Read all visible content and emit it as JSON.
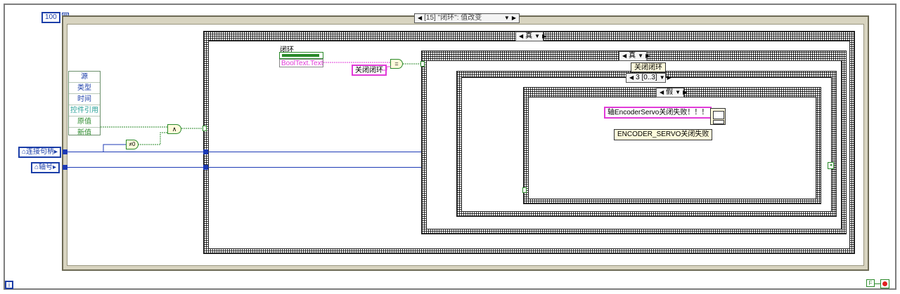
{
  "while_loop": {
    "count_constant": "100",
    "stop_terminal": "F"
  },
  "event_structure": {
    "selector": "[15] \"闭环\": 值改变",
    "event_data_items": [
      {
        "label": "源",
        "color": "#1b3ea8"
      },
      {
        "label": "类型",
        "color": "#1b3ea8"
      },
      {
        "label": "时间",
        "color": "#1b3ea8"
      },
      {
        "label": "控件引用",
        "color": "#2aa198"
      },
      {
        "label": "原值",
        "color": "#2a8a2a"
      },
      {
        "label": "新值",
        "color": "#2a8a2a"
      }
    ]
  },
  "terminals": {
    "connection_handle": "连接句柄",
    "axis_number": "轴号"
  },
  "case_outer": {
    "selector": "真"
  },
  "boolean_control": {
    "label": "闭环",
    "property": "BoolText.Text"
  },
  "string_constant_close": "关闭闭环",
  "case_inner": {
    "selector": "真"
  },
  "flat_sequence_label": "关闭闭环",
  "sequence_selector": "3 [0..3]",
  "case_false": {
    "selector": "假"
  },
  "message_string": "轴EncoderServo关闭失败！！！",
  "error_label": "ENCODER_SERVO关闭失败",
  "primitives": {
    "and_symbol": "∧",
    "not_equal_symbol": "≠0",
    "equal_symbol": "="
  }
}
